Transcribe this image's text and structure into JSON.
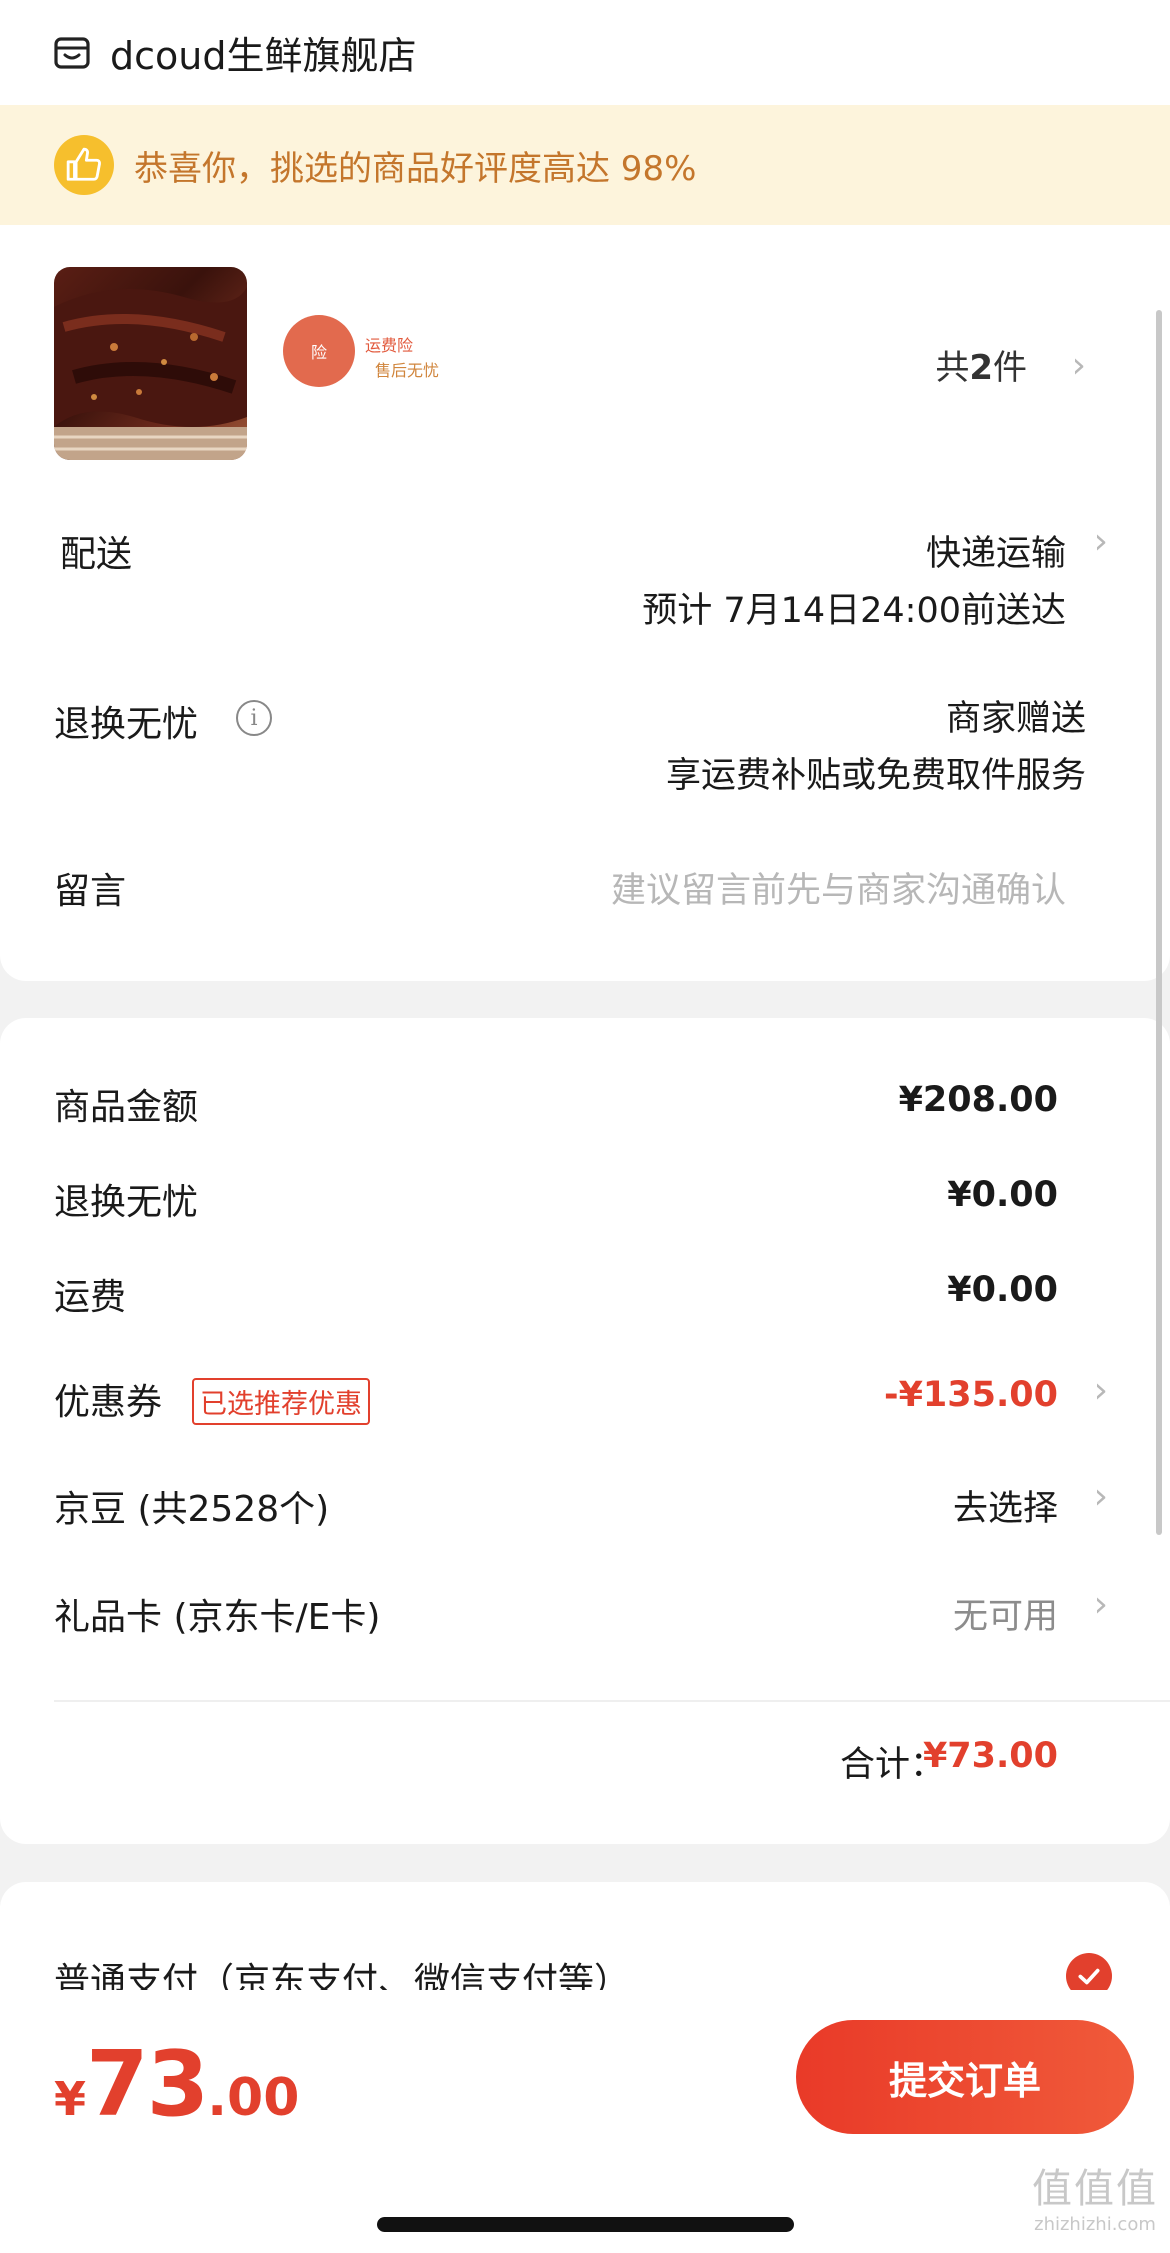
{
  "store": {
    "name": "dcoud生鲜旗舰店",
    "icon": "store-icon"
  },
  "banner": {
    "text": "恭喜你，挑选的商品好评度高达 98%",
    "icon": "thumbs-up-icon"
  },
  "product": {
    "badge_char": "险",
    "badge_line1": "运费险",
    "badge_line2": "售后无忧",
    "count_prefix": "共",
    "count": "2",
    "count_suffix": "件"
  },
  "delivery": {
    "label": "配送",
    "method": "快递运输",
    "eta": "预计 7月14日24:00前送达"
  },
  "returns": {
    "label": "退换无忧",
    "line1": "商家赠送",
    "line2": "享运费补贴或免费取件服务"
  },
  "message": {
    "label": "留言",
    "placeholder": "建议留言前先与商家沟通确认"
  },
  "summary": {
    "goods_label": "商品金额",
    "goods_value": "¥208.00",
    "returns_label": "退换无忧",
    "returns_value": "¥0.00",
    "shipping_label": "运费",
    "shipping_value": "¥0.00",
    "coupon_label": "优惠券",
    "coupon_tag": "已选推荐优惠",
    "coupon_value": "-¥135.00",
    "beans_label": "京豆 (共2528个)",
    "beans_value": "去选择",
    "giftcard_label": "礼品卡 (京东卡/E卡)",
    "giftcard_value": "无可用",
    "total_label": "合计：",
    "total_value": "¥73.00"
  },
  "payment": {
    "label": "普通支付（京东支付、微信支付等）",
    "selected": true
  },
  "footer": {
    "currency": "¥",
    "price_int": "73",
    "price_dec": ".00",
    "submit_label": "提交订单"
  },
  "watermark": {
    "logo": "值值值",
    "url": "zhizhizhi.com"
  },
  "colors": {
    "accent": "#e2402d",
    "banner_bg": "#fdf4dc",
    "banner_text": "#c4762c"
  }
}
